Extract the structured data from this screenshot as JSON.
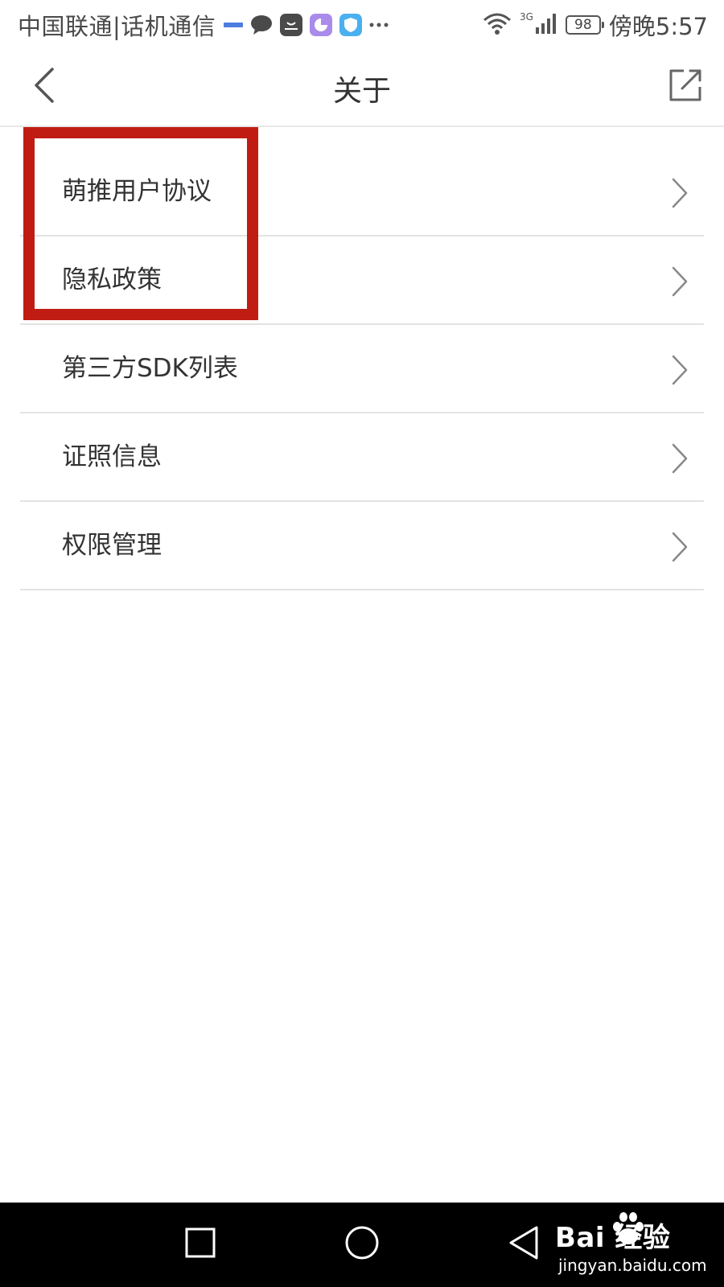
{
  "status_bar": {
    "carrier": "中国联通|话机通信",
    "notification_icons": [
      "carrier-tag-icon",
      "chat-icon",
      "huawei-store-icon",
      "purple-app-icon",
      "shield-app-icon",
      "more-icon"
    ],
    "network_label": "3G",
    "battery": "98",
    "time": "傍晚5:57"
  },
  "header": {
    "title": "关于",
    "back_icon": "chevron-left-icon",
    "share_icon": "share-icon"
  },
  "list": {
    "items": [
      {
        "label": "萌推用户协议"
      },
      {
        "label": "隐私政策"
      },
      {
        "label": "第三方SDK列表"
      },
      {
        "label": "证照信息"
      },
      {
        "label": "权限管理"
      }
    ]
  },
  "annotation": {
    "color": "#c01c14"
  },
  "nav_bar": {
    "buttons": [
      "recent-apps-icon",
      "home-icon",
      "back-icon"
    ]
  },
  "watermark": {
    "brand": "Bai  经验",
    "url": "jingyan.baidu.com"
  }
}
